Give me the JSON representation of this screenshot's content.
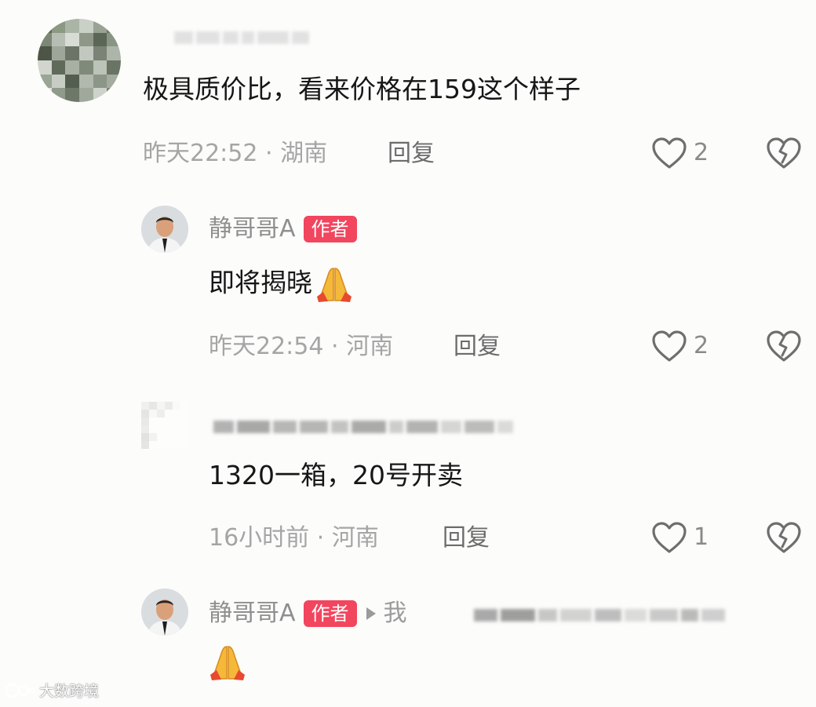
{
  "comments": [
    {
      "username": "",
      "text": "极具质价比，看来价格在159这个样子",
      "time": "昨天22:52",
      "location": "湖南",
      "reply_label": "回复",
      "likes": "2"
    },
    {
      "username": "静哥哥A",
      "badge": "作者",
      "text": "即将揭晓",
      "time": "昨天22:54",
      "location": "河南",
      "reply_label": "回复",
      "likes": "2"
    },
    {
      "username": "",
      "text": "1320一箱，20号开卖",
      "time": "16小时前",
      "location": "河南",
      "reply_label": "回复",
      "likes": "1"
    },
    {
      "username": "静哥哥A",
      "badge": "作者",
      "reply_to_prefix": "我",
      "text": ""
    }
  ],
  "separator": "·",
  "watermark": "大数跨境",
  "colors": {
    "badge": "#f2455e",
    "meta": "#a5a5a5",
    "text": "#161616"
  },
  "icons": [
    "heart-icon",
    "broken-heart-icon",
    "praying-hands-emoji",
    "reply-arrow-icon"
  ]
}
